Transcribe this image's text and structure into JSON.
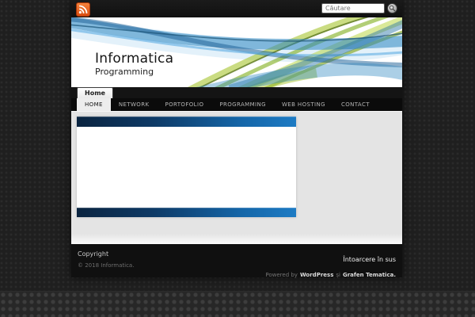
{
  "topbar": {
    "search_placeholder": "Căutare"
  },
  "header": {
    "title": "Informatica",
    "subtitle": "Programming"
  },
  "page_tab": "Home",
  "nav": {
    "items": [
      {
        "label": "HOME",
        "active": true
      },
      {
        "label": "NETWORK",
        "active": false
      },
      {
        "label": "PORTOFOLIO",
        "active": false
      },
      {
        "label": "PROGRAMMING",
        "active": false
      },
      {
        "label": "WEB HOSTING",
        "active": false
      },
      {
        "label": "CONTACT",
        "active": false
      }
    ]
  },
  "footer": {
    "copyright_label": "Copyright",
    "copyright_notice": "© 2018 Informatica.",
    "back_to_top": "Întoarcere în sus",
    "powered_by": "Powered by",
    "wordpress": "WordPress",
    "conjunction": "și",
    "theme": "Grafen Tematica."
  },
  "icons": {
    "rss": "rss-icon",
    "search": "search-icon"
  },
  "colors": {
    "accent_bar_dark": "#0a2440",
    "accent_bar_light": "#1d7bc4",
    "rss_orange": "#e8561f",
    "swoosh_blue": "#2e86c1",
    "swoosh_green": "#a6c42e",
    "nav_bg": "#0b0b0b",
    "content_bg": "#e4e4e4",
    "footer_bg": "#101010"
  }
}
